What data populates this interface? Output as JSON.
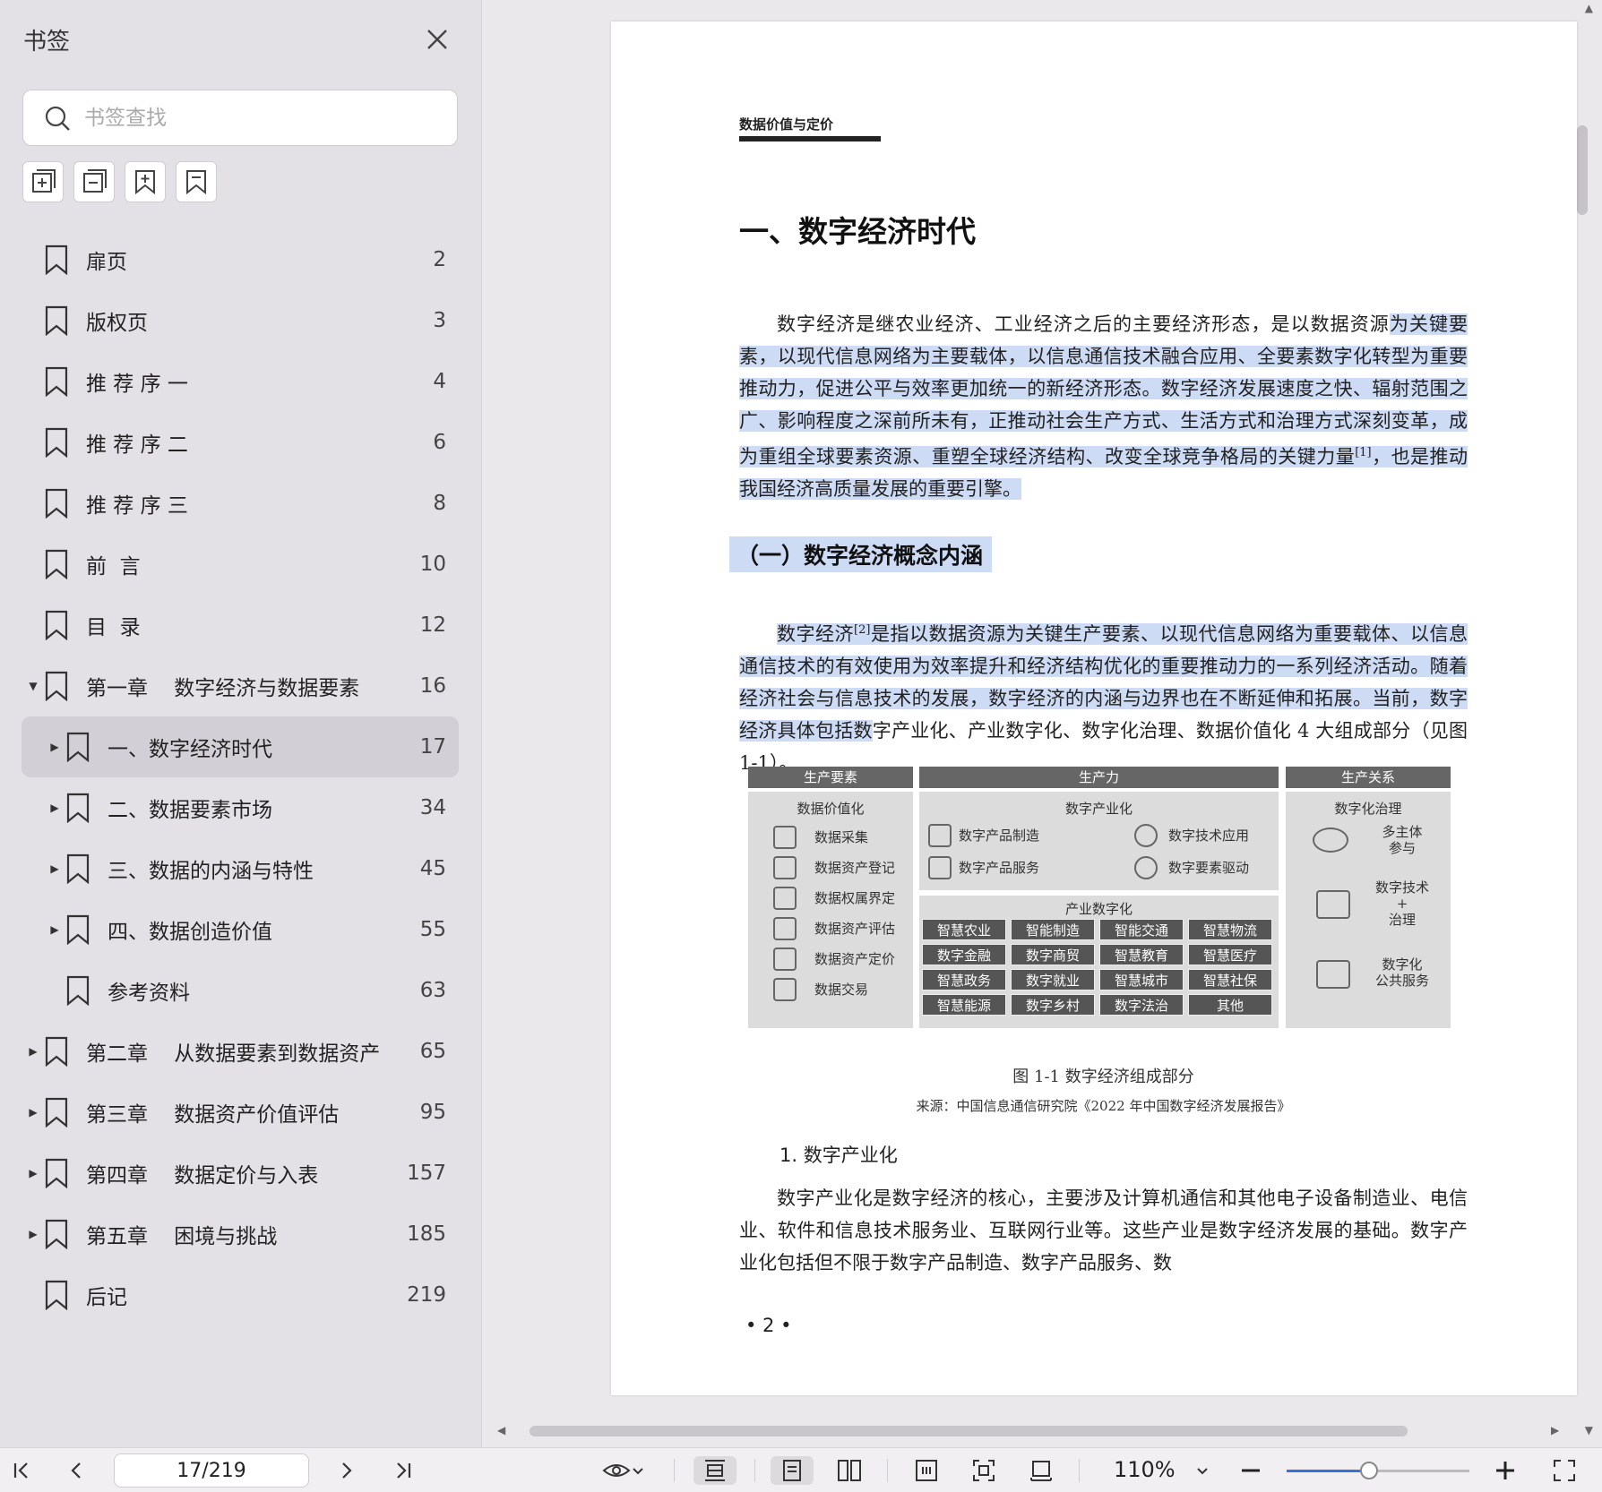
{
  "sidebar": {
    "title": "书签",
    "search_placeholder": "书签查找",
    "tools": [
      "expand-all-icon",
      "collapse-all-icon",
      "add-bookmark-icon",
      "bookmark-icon"
    ],
    "items": [
      {
        "label": "扉页",
        "page": "2",
        "level": 0,
        "arrow": ""
      },
      {
        "label": "版权页",
        "page": "3",
        "level": 0,
        "arrow": ""
      },
      {
        "label": "推 荐 序 一",
        "page": "4",
        "level": 0,
        "arrow": ""
      },
      {
        "label": "推 荐 序 二",
        "page": "6",
        "level": 0,
        "arrow": ""
      },
      {
        "label": "推 荐 序 三",
        "page": "8",
        "level": 0,
        "arrow": ""
      },
      {
        "label": "前  言",
        "page": "10",
        "level": 0,
        "arrow": ""
      },
      {
        "label": "目  录",
        "page": "12",
        "level": 0,
        "arrow": ""
      },
      {
        "label": "第一章    数字经济与数据要素",
        "page": "16",
        "level": 0,
        "arrow": "down"
      },
      {
        "label": "一、数字经济时代",
        "page": "17",
        "level": 1,
        "arrow": "right",
        "active": true
      },
      {
        "label": "二、数据要素市场",
        "page": "34",
        "level": 1,
        "arrow": "right"
      },
      {
        "label": "三、数据的内涵与特性",
        "page": "45",
        "level": 1,
        "arrow": "right"
      },
      {
        "label": "四、数据创造价值",
        "page": "55",
        "level": 1,
        "arrow": "right"
      },
      {
        "label": "参考资料",
        "page": "63",
        "level": 1,
        "arrow": ""
      },
      {
        "label": "第二章    从数据要素到数据资产",
        "page": "65",
        "level": 0,
        "arrow": "right"
      },
      {
        "label": "第三章    数据资产价值评估",
        "page": "95",
        "level": 0,
        "arrow": "right"
      },
      {
        "label": "第四章    数据定价与入表",
        "page": "157",
        "level": 0,
        "arrow": "right"
      },
      {
        "label": "第五章    困境与挑战",
        "page": "185",
        "level": 0,
        "arrow": "right"
      },
      {
        "label": "后记",
        "page": "219",
        "level": 0,
        "arrow": ""
      }
    ]
  },
  "document": {
    "running_head": "数据价值与定价",
    "h1": "一、数字经济时代",
    "p1_a": "数字经济是继农业经济、工业经济之后的主要经济形态，是以数据资源",
    "p1_b": "为关键要素，以现代信息网络为主要载体，以信息通信技术融合应用、全要素数字化转型为重要推动力，促进公平与效率更加统一的新经济形态。数字经济发展速度之快、辐射范围之广、影响程度之深前所未有，正推动社会生产方式、生活方式和治理方式深刻变革，成为重组全球要素资源、重塑全球经济结构、改变全球竞争格局的关键力量",
    "p1_ref": "[1]",
    "p1_c": "，也是推动我国经济高质量发展的重要引擎。",
    "h2": "（一）数字经济概念内涵",
    "p2_a": "数字经济",
    "p2_ref": "[2]",
    "p2_b": "是指以数据资源为关键生产要素、以现代信息网络为重要载体、以信息通信技术的有效使用为效率提升和经济结构优化的重要推动力的一系列经济活动。随着经济社会与信息技术的发展，数字经济的内涵与边界也在不断延伸和拓展。当前，数字经济具体包括数",
    "p2_c": "字产业化、产业数字化、数字化治理、数据价值化 4 大组成部分（见图 1-1）。",
    "figure": {
      "col1_head": "生产要素",
      "col2_head": "生产力",
      "col3_head": "生产关系",
      "col1_title": "数据价值化",
      "col1_items": [
        "数据采集",
        "数据资产登记",
        "数据权属界定",
        "数据资产评估",
        "数据资产定价",
        "数据交易"
      ],
      "col2_title": "数字产业化",
      "col2_items": [
        "数字产品制造",
        "数字技术应用",
        "数字产品服务",
        "数字要素驱动"
      ],
      "col2b_title": "产业数字化",
      "grid": [
        "智慧农业",
        "智能制造",
        "智能交通",
        "智慧物流",
        "数字金融",
        "数字商贸",
        "智慧教育",
        "智慧医疗",
        "智慧政务",
        "数字就业",
        "智慧城市",
        "智慧社保",
        "智慧能源",
        "数字乡村",
        "数字法治",
        "其他"
      ],
      "col3_title": "数字化治理",
      "col3_items": [
        "多主体\n参与",
        "数字技术\n+\n治理",
        "数字化\n公共服务"
      ]
    },
    "fig_caption": "图 1-1    数字经济组成部分",
    "fig_source": "来源：中国信息通信研究院《2022 年中国数字经济发展报告》",
    "numhead": "1.  数字产业化",
    "p3": "数字产业化是数字经济的核心，主要涉及计算机通信和其他电子设备制造业、电信业、软件和信息技术服务业、互联网行业等。这些产业是数字经济发展的基础。数字产业化包括但不限于数字产品制造、数字产品服务、数",
    "page_number": "• 2 •"
  },
  "toolbar": {
    "page_value": "17/219",
    "zoom": "110%",
    "zoom_fraction": 0.45
  }
}
